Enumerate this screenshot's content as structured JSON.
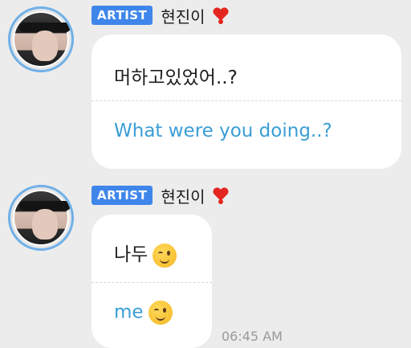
{
  "messages": [
    {
      "badge": "ARTIST",
      "name": "현진이",
      "korean": "머하고있었어..?",
      "english": "What were you doing..?"
    },
    {
      "badge": "ARTIST",
      "name": "현진이",
      "korean": "나두",
      "english": "me",
      "time": "06:45 AM"
    }
  ]
}
